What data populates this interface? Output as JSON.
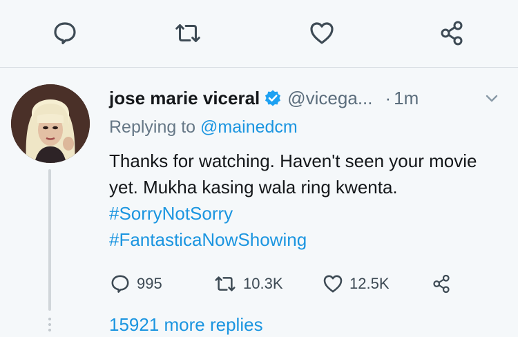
{
  "colors": {
    "accent": "#1b95e0",
    "muted": "#657786",
    "text": "#14171a",
    "verified": "#1da1f2"
  },
  "top_actions": [
    {
      "icon": "reply-icon"
    },
    {
      "icon": "retweet-icon"
    },
    {
      "icon": "like-icon"
    },
    {
      "icon": "share-icon"
    }
  ],
  "tweet": {
    "author_name": "jose marie viceral",
    "verified": true,
    "handle": "@vicega...",
    "separator": "·",
    "time": "1m",
    "replying_prefix": "Replying to",
    "replying_to": "@mainedcm",
    "text_plain": "Thanks for watching. Haven't seen your movie yet. Mukha kasing wala ring kwenta.",
    "hashtags": [
      "#SorryNotSorry",
      "#FantasticaNowShowing"
    ],
    "stats": {
      "replies": "995",
      "retweets": "10.3K",
      "likes": "12.5K"
    }
  },
  "more_replies": "15921 more replies"
}
